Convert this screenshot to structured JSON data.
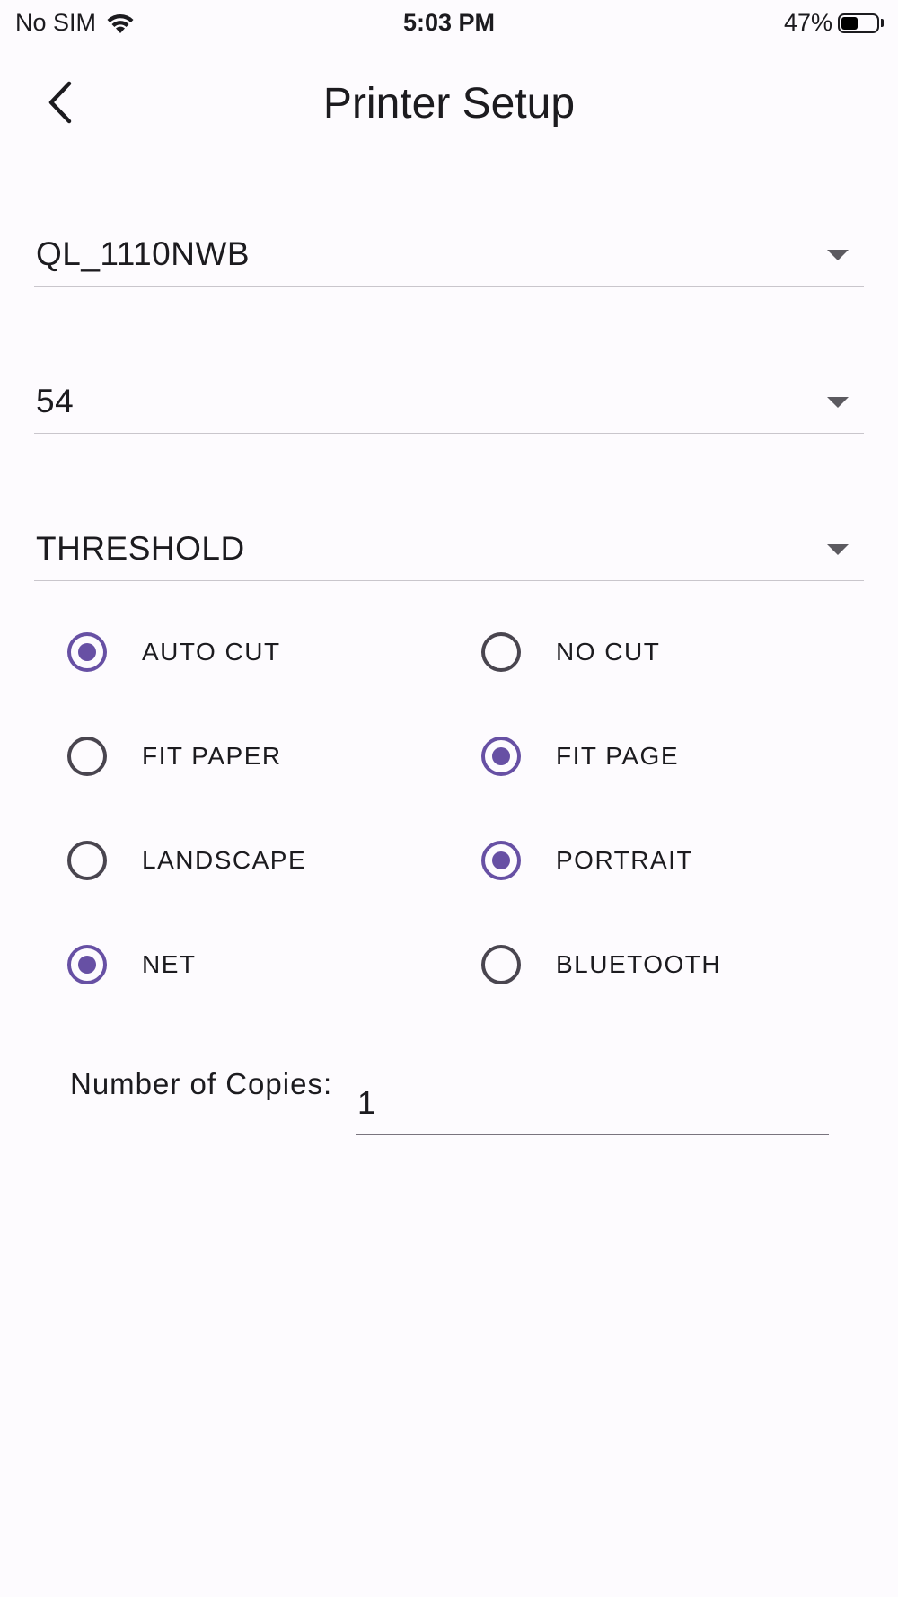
{
  "status_bar": {
    "carrier": "No SIM",
    "time": "5:03 PM",
    "battery_percent": "47%",
    "battery_level": 0.47,
    "wifi_icon": "wifi-icon",
    "battery_icon": "battery-icon"
  },
  "app_bar": {
    "title": "Printer Setup",
    "back_icon": "chevron-left-icon"
  },
  "dropdowns": {
    "printer_model": "QL_1110NWB",
    "label_size": "54",
    "print_mode": "THRESHOLD"
  },
  "options": {
    "auto_cut": {
      "label": "AUTO CUT",
      "checked": true
    },
    "no_cut": {
      "label": "NO CUT",
      "checked": false
    },
    "fit_paper": {
      "label": "FIT PAPER",
      "checked": false
    },
    "fit_page": {
      "label": "FIT PAGE",
      "checked": true
    },
    "landscape": {
      "label": "LANDSCAPE",
      "checked": false
    },
    "portrait": {
      "label": "PORTRAIT",
      "checked": true
    },
    "net": {
      "label": "NET",
      "checked": true
    },
    "bluetooth": {
      "label": "BLUETOOTH",
      "checked": false
    }
  },
  "copies": {
    "label": "Number of Copies:",
    "value": "1"
  },
  "colors": {
    "accent": "#6750a4",
    "background": "#fdfbfe",
    "text": "#1c1b1f"
  }
}
